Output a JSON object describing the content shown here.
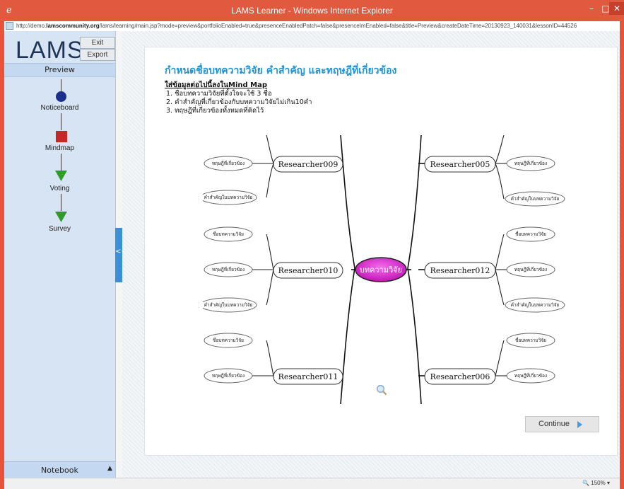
{
  "window": {
    "title": "LAMS Learner - Windows Internet Explorer",
    "min": "–",
    "max": "□",
    "close": "✕"
  },
  "address": {
    "prefix": "http://demo.",
    "domain": "lamscommunity.org",
    "path": "/lams/learning/main.jsp?mode=preview&portfolioEnabled=true&presenceEnabledPatch=false&presenceImEnabled=false&title=Preview&createDateTime=20130923_140031&lessonID=44526"
  },
  "sidebar": {
    "logo": "LAMS",
    "exit_label": "Exit",
    "export_label": "Export",
    "preview_label": "Preview",
    "activities": [
      {
        "label": "Noticeboard",
        "icon": "circle-icon",
        "color": "#1c2f8c"
      },
      {
        "label": "Mindmap",
        "icon": "square-icon",
        "color": "#c62828"
      },
      {
        "label": "Voting",
        "icon": "triangle-down-icon",
        "color": "#2e9c2b"
      },
      {
        "label": "Survey",
        "icon": "triangle-down-icon",
        "color": "#2e9c2b"
      }
    ],
    "notebook_label": "Notebook",
    "notebook_arrow": "▲",
    "toggle_label": "<<"
  },
  "main": {
    "heading": "กำหนดชื่อบทความวิจัย คำสำคัญ และทฤษฎีที่เกี่ยวข้อง",
    "instructions_title": "ใส่ข้อมูลต่อไปนี้ลงในMind Map",
    "instructions": [
      "1.  ชื่อบทความวิจัยที่ตั้งใจจะใช้ 3 ชื่อ",
      "2.  คำสำคัญที่เกี่ยวข้องกับบทความวิจัยไม่เกิน10คำ",
      "3.  ทฤษฎีที่เกี่ยวข้องทั้งหมดที่คิดไว้"
    ],
    "mindmap": {
      "center": "บทความวิจัย",
      "researchers": {
        "r009": "Researcher009",
        "r005": "Researcher005",
        "r010": "Researcher010",
        "r012": "Researcher012",
        "r011": "Researcher011",
        "r006": "Researcher006"
      },
      "leaf_theory": "ทฤษฎีที่เกี่ยวข้อง",
      "leaf_keyword": "คำสำคัญในบทความวิจัย",
      "leaf_title": "ชื่อบทความวิจัย"
    },
    "continue_label": "Continue"
  },
  "status": {
    "zoom": "150%"
  },
  "colors": {
    "accent": "#1f93d2",
    "center_node": "#d81ec9",
    "titlebar": "#e15a3f"
  }
}
